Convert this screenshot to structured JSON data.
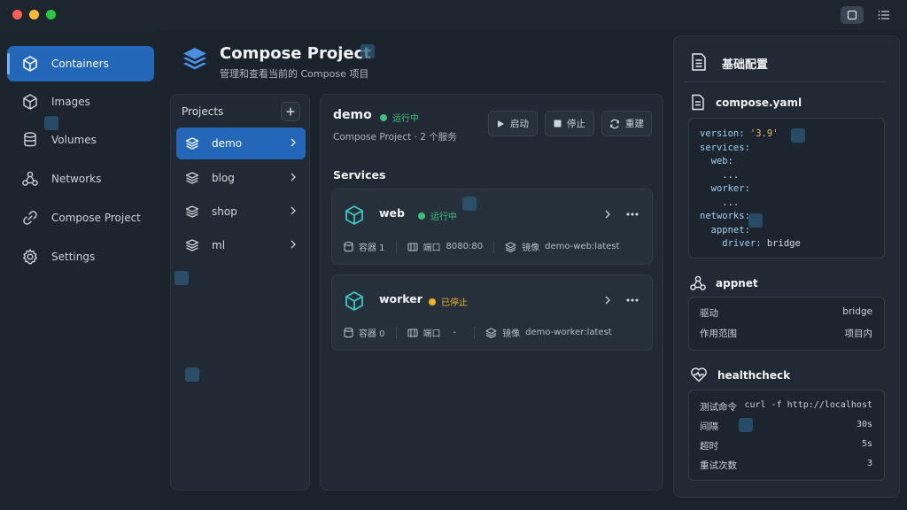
{
  "window": {
    "traffic_colors": [
      "#ff5f57",
      "#febc2e",
      "#28c840"
    ]
  },
  "sidebar": {
    "items": [
      {
        "label": "Containers",
        "icon": "cube-icon",
        "active": true
      },
      {
        "label": "Images",
        "icon": "box-icon"
      },
      {
        "label": "Volumes",
        "icon": "database-icon"
      },
      {
        "label": "Networks",
        "icon": "network-icon"
      },
      {
        "label": "Compose Project",
        "icon": "link-icon"
      },
      {
        "label": "Settings",
        "icon": "gear-icon"
      }
    ]
  },
  "header": {
    "title": "Compose Project",
    "subtitle": "管理和查看当前的 Compose 项目"
  },
  "projects": {
    "heading": "Projects",
    "items": [
      {
        "label": "demo",
        "active": true
      },
      {
        "label": "blog"
      },
      {
        "label": "shop"
      },
      {
        "label": "ml"
      }
    ]
  },
  "project_detail": {
    "name": "demo",
    "status": "运行中",
    "subtitle": "Compose Project · 2 个服务",
    "actions": {
      "start": "启动",
      "stop": "停止",
      "rebuild": "重建"
    },
    "services_title": "Services",
    "services": [
      {
        "name": "web",
        "status": "运行中",
        "status_color": "#3fbf7f",
        "containers": "容器 1",
        "port_label": "端口",
        "port": "8080:80",
        "image_label": "镜像",
        "image": "demo-web:latest"
      },
      {
        "name": "worker",
        "status": "已停止",
        "status_color": "#f0b429",
        "containers": "容器 0",
        "port_label": "端口",
        "port": "-",
        "image_label": "镜像",
        "image": "demo-worker:latest"
      }
    ]
  },
  "config": {
    "title": "基础配置",
    "compose_file": {
      "name": "compose.yaml",
      "lines": [
        {
          "key": "version: ",
          "val": "'3.9'"
        },
        {
          "key": "services:",
          "val": ""
        },
        {
          "key": "  web:",
          "val": ""
        },
        {
          "key": "    ...",
          "val": ""
        },
        {
          "key": "  worker:",
          "val": ""
        },
        {
          "key": "    ...",
          "val": ""
        },
        {
          "key": "networks:",
          "val": ""
        },
        {
          "key": "  appnet:",
          "val": ""
        },
        {
          "key": "    driver: ",
          "val": "bridge"
        }
      ]
    },
    "network": {
      "name": "appnet",
      "rows": [
        {
          "k": "驱动",
          "v": "bridge"
        },
        {
          "k": "作用范围",
          "v": "项目内"
        }
      ]
    },
    "healthcheck": {
      "name": "healthcheck",
      "rows": [
        {
          "k": "测试命令",
          "v": "curl -f http://localhost"
        },
        {
          "k": "间隔",
          "v": "30s"
        },
        {
          "k": "超时",
          "v": "5s"
        },
        {
          "k": "重试次数",
          "v": "3"
        }
      ]
    }
  },
  "colors": {
    "accent": "#2467b8",
    "running": "#3fbf7f",
    "stopped": "#f0b429",
    "teal_icon": "#3ec7c0"
  }
}
